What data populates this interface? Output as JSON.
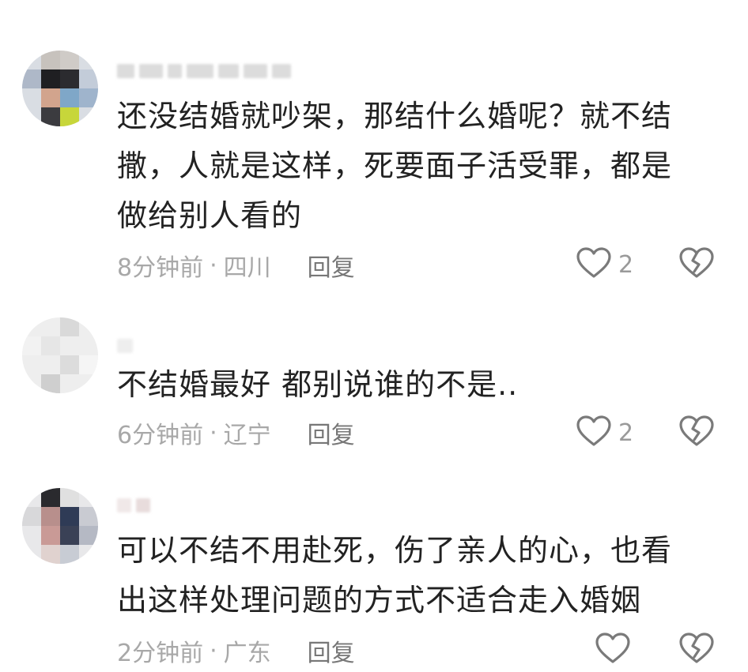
{
  "comments": [
    {
      "text": "还没结婚就吵架，那结什么婚呢？就不结撒，人就是这样，死要面子活受罪，都是做给别人看的",
      "time": "8分钟前",
      "separator": "·",
      "location": "四川",
      "reply_label": "回复",
      "like_count": "2"
    },
    {
      "text": "不结婚最好 都别说谁的不是..",
      "time": "6分钟前",
      "separator": "·",
      "location": "辽宁",
      "reply_label": "回复",
      "like_count": "2"
    },
    {
      "text": "可以不结不用赴死，伤了亲人的心，也看出这样处理问题的方式不适合走入婚姻",
      "time": "2分钟前",
      "separator": "·",
      "location": "广东",
      "reply_label": "回复",
      "like_count": ""
    }
  ],
  "icons": {
    "like": "heart-outline-icon",
    "dislike": "broken-heart-icon"
  },
  "colors": {
    "text": "#222222",
    "meta": "#a8a8a8",
    "reply": "#777777",
    "icon": "#7a7a7a"
  }
}
